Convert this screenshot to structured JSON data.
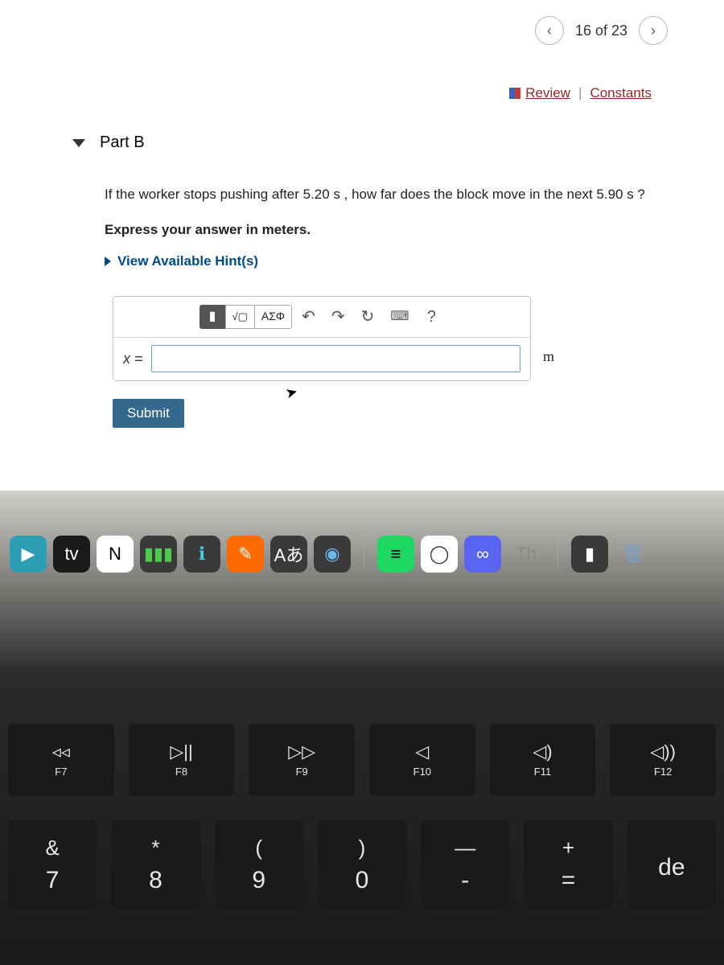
{
  "nav": {
    "prev_icon": "‹",
    "count_text": "16 of 23",
    "next_icon": "›"
  },
  "links": {
    "review": "Review",
    "constants": "Constants"
  },
  "part": {
    "label": "Part B",
    "question": "If the worker stops pushing after 5.20 s , how far does the block move in the next 5.90 s ?",
    "instruction": "Express your answer in meters.",
    "hints_label": "View Available Hint(s)"
  },
  "toolbar": {
    "templates": "▮",
    "root": "√▢",
    "greek": "ΑΣΦ",
    "undo": "↶",
    "redo": "↷",
    "reset": "↻",
    "keyboard": "⌨",
    "help": "?"
  },
  "answer": {
    "var": "x =",
    "unit": "m"
  },
  "submit_label": "Submit",
  "dock": {
    "items": [
      {
        "name": "prime-video",
        "glyph": "▶",
        "bg": "#2b9eb3"
      },
      {
        "name": "apple-tv",
        "glyph": "tv",
        "bg": "#1a1a1a"
      },
      {
        "name": "notion",
        "glyph": "N",
        "bg": "#fff",
        "color": "#000"
      },
      {
        "name": "numbers",
        "glyph": "▮▮▮",
        "bg": "#3a3a3a",
        "color": "#4ec94e"
      },
      {
        "name": "info",
        "glyph": "ℹ",
        "bg": "#3a3a3a",
        "color": "#3bd0e0"
      },
      {
        "name": "markup",
        "glyph": "✎",
        "bg": "#ff6a00"
      },
      {
        "name": "translate",
        "glyph": "Aあ",
        "bg": "#3a3a3a"
      },
      {
        "name": "shazam",
        "glyph": "◉",
        "bg": "#3a3a3a",
        "color": "#6bb7f0"
      },
      {
        "name": "spotify",
        "glyph": "≡",
        "bg": "#1ed760",
        "color": "#000"
      },
      {
        "name": "chrome",
        "glyph": "◯",
        "bg": "#fff",
        "color": "#333"
      },
      {
        "name": "discord",
        "glyph": "∞",
        "bg": "#5865f2"
      },
      {
        "name": "th-app",
        "glyph": "Th",
        "bg": "transparent",
        "color": "#888"
      },
      {
        "name": "flag-app",
        "glyph": "▮",
        "bg": "#3a3a3a"
      },
      {
        "name": "trash",
        "glyph": "🗑",
        "bg": "transparent",
        "color": "#7aa0c4"
      }
    ]
  },
  "keyboard": {
    "frow": [
      {
        "icon": "◃◃",
        "label": "F7"
      },
      {
        "icon": "▷||",
        "label": "F8"
      },
      {
        "icon": "▷▷",
        "label": "F9"
      },
      {
        "icon": "◁",
        "label": "F10"
      },
      {
        "icon": "◁)",
        "label": "F11"
      },
      {
        "icon": "◁))",
        "label": "F12"
      }
    ],
    "numrow": [
      {
        "top": "&",
        "bottom": "7"
      },
      {
        "top": "*",
        "bottom": "8"
      },
      {
        "top": "(",
        "bottom": "9"
      },
      {
        "top": ")",
        "bottom": "0"
      },
      {
        "top": "—",
        "bottom": "-"
      },
      {
        "top": "+",
        "bottom": "="
      },
      {
        "top": "",
        "bottom": "de"
      }
    ]
  }
}
